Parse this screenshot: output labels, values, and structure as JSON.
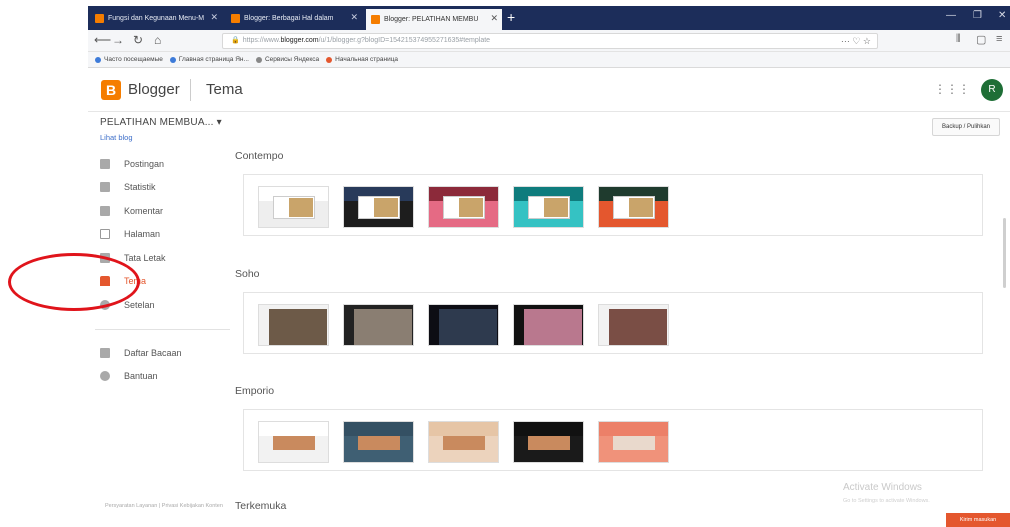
{
  "browser": {
    "tabs": [
      {
        "label": "Fungsi dan Kegunaan Menu-M",
        "fav_color": "#f57d00"
      },
      {
        "label": "Blogger: Berbagai Hal dalam",
        "fav_color": "#f57d00"
      },
      {
        "label": "Blogger: PELATIHAN MEMBU",
        "fav_color": "#f57d00"
      }
    ],
    "new_tab": "+",
    "url_prefix": "https://www.",
    "url_domain": "blogger.com",
    "url_rest": "/u/1/blogger.g?blogID=154215374955271635#template",
    "bookmarks": [
      {
        "label": "Часто посещаемые",
        "color": "#3d7bd9"
      },
      {
        "label": "Главная страница Ян...",
        "color": "#3d7bd9"
      },
      {
        "label": "Сервисы Яндекса",
        "color": "#888888"
      },
      {
        "label": "Начальная страница",
        "color": "#e4572e"
      }
    ]
  },
  "app": {
    "logo_letter": "B",
    "brand": "Blogger",
    "page_title": "Tema",
    "avatar_letter": "R",
    "blog_name": "PELATIHAN MEMBUA... ▾",
    "view_blog": "Lihat blog",
    "backup_label": "Backup / Pulihkan"
  },
  "sidebar": {
    "items": [
      {
        "label": "Postingan",
        "icon": "posts-icon"
      },
      {
        "label": "Statistik",
        "icon": "stats-icon"
      },
      {
        "label": "Komentar",
        "icon": "comments-icon"
      },
      {
        "label": "Halaman",
        "icon": "pages-icon"
      },
      {
        "label": "Tata Letak",
        "icon": "layout-icon"
      },
      {
        "label": "Tema",
        "icon": "theme-icon",
        "active": true
      },
      {
        "label": "Setelan",
        "icon": "settings-icon"
      }
    ],
    "secondary": [
      {
        "label": "Daftar Bacaan",
        "icon": "reading-list-icon"
      },
      {
        "label": "Bantuan",
        "icon": "help-icon"
      }
    ],
    "footer": "Persyaratan Layanan | Privasi\nKebijakan Konten"
  },
  "themes": [
    {
      "title": "Contempo"
    },
    {
      "title": "Soho"
    },
    {
      "title": "Emporio"
    },
    {
      "title": "Terkemuka"
    }
  ],
  "overlay": {
    "activate_title": "Activate Windows",
    "activate_sub": "Go to Settings to activate Windows.",
    "feedback": "Kirim masukan"
  },
  "colors": {
    "accent": "#e4572e",
    "blogger_orange": "#f57d00",
    "highlight_circle": "#e0141b"
  }
}
